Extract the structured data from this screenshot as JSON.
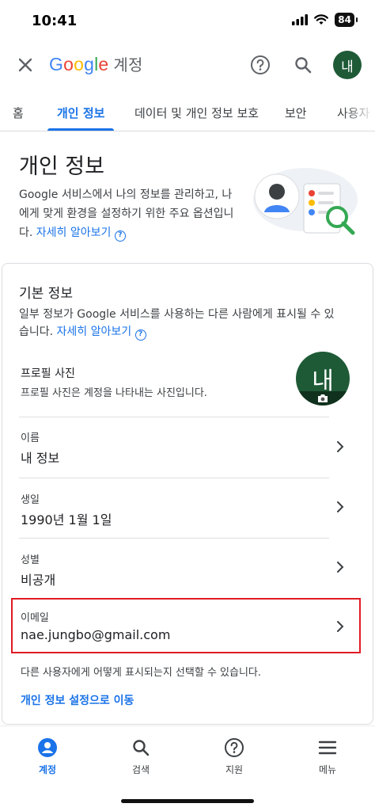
{
  "status_bar": {
    "time": "10:41",
    "battery": "84"
  },
  "app_bar": {
    "logo_letters": [
      "G",
      "o",
      "o",
      "g",
      "l",
      "e"
    ],
    "logo_suffix": "계정",
    "avatar_initial": "내"
  },
  "tabs": [
    {
      "label": "홈"
    },
    {
      "label": "개인 정보",
      "active": true
    },
    {
      "label": "데이터 및 개인 정보 보호"
    },
    {
      "label": "보안"
    },
    {
      "label": "사용자"
    }
  ],
  "header": {
    "title": "개인 정보",
    "intro": "Google 서비스에서 나의 정보를 관리하고, 나에게 맞게 환경을 설정하기 위한 주요 옵션입니다.",
    "learn_more": "자세히 알아보기"
  },
  "basic_info": {
    "title": "기본 정보",
    "description": "일부 정보가 Google 서비스를 사용하는 다른 사람에게 표시될 수 있습니다.",
    "learn_more": "자세히 알아보기",
    "profile_photo": {
      "label": "프로필 사진",
      "sub": "프로필 사진은 계정을 나타내는 사진입니다.",
      "initial": "내"
    },
    "rows": [
      {
        "label": "이름",
        "value": "내 정보"
      },
      {
        "label": "생일",
        "value": "1990년 1월 1일"
      },
      {
        "label": "성별",
        "value": "비공개"
      },
      {
        "label": "이메일",
        "value": "nae.jungbo@gmail.com"
      }
    ],
    "visibility_note": "다른 사용자에게 어떻게 표시되는지 선택할 수 있습니다.",
    "settings_link": "개인 정보 설정으로 이동"
  },
  "bottom_nav": [
    {
      "label": "계정",
      "icon": "account-icon",
      "active": true
    },
    {
      "label": "검색",
      "icon": "search-icon"
    },
    {
      "label": "지원",
      "icon": "help-icon"
    },
    {
      "label": "메뉴",
      "icon": "menu-icon"
    }
  ],
  "colors": {
    "accent": "#1a73e8",
    "avatar_bg": "#1e5a36",
    "highlight": "#e01b24"
  }
}
